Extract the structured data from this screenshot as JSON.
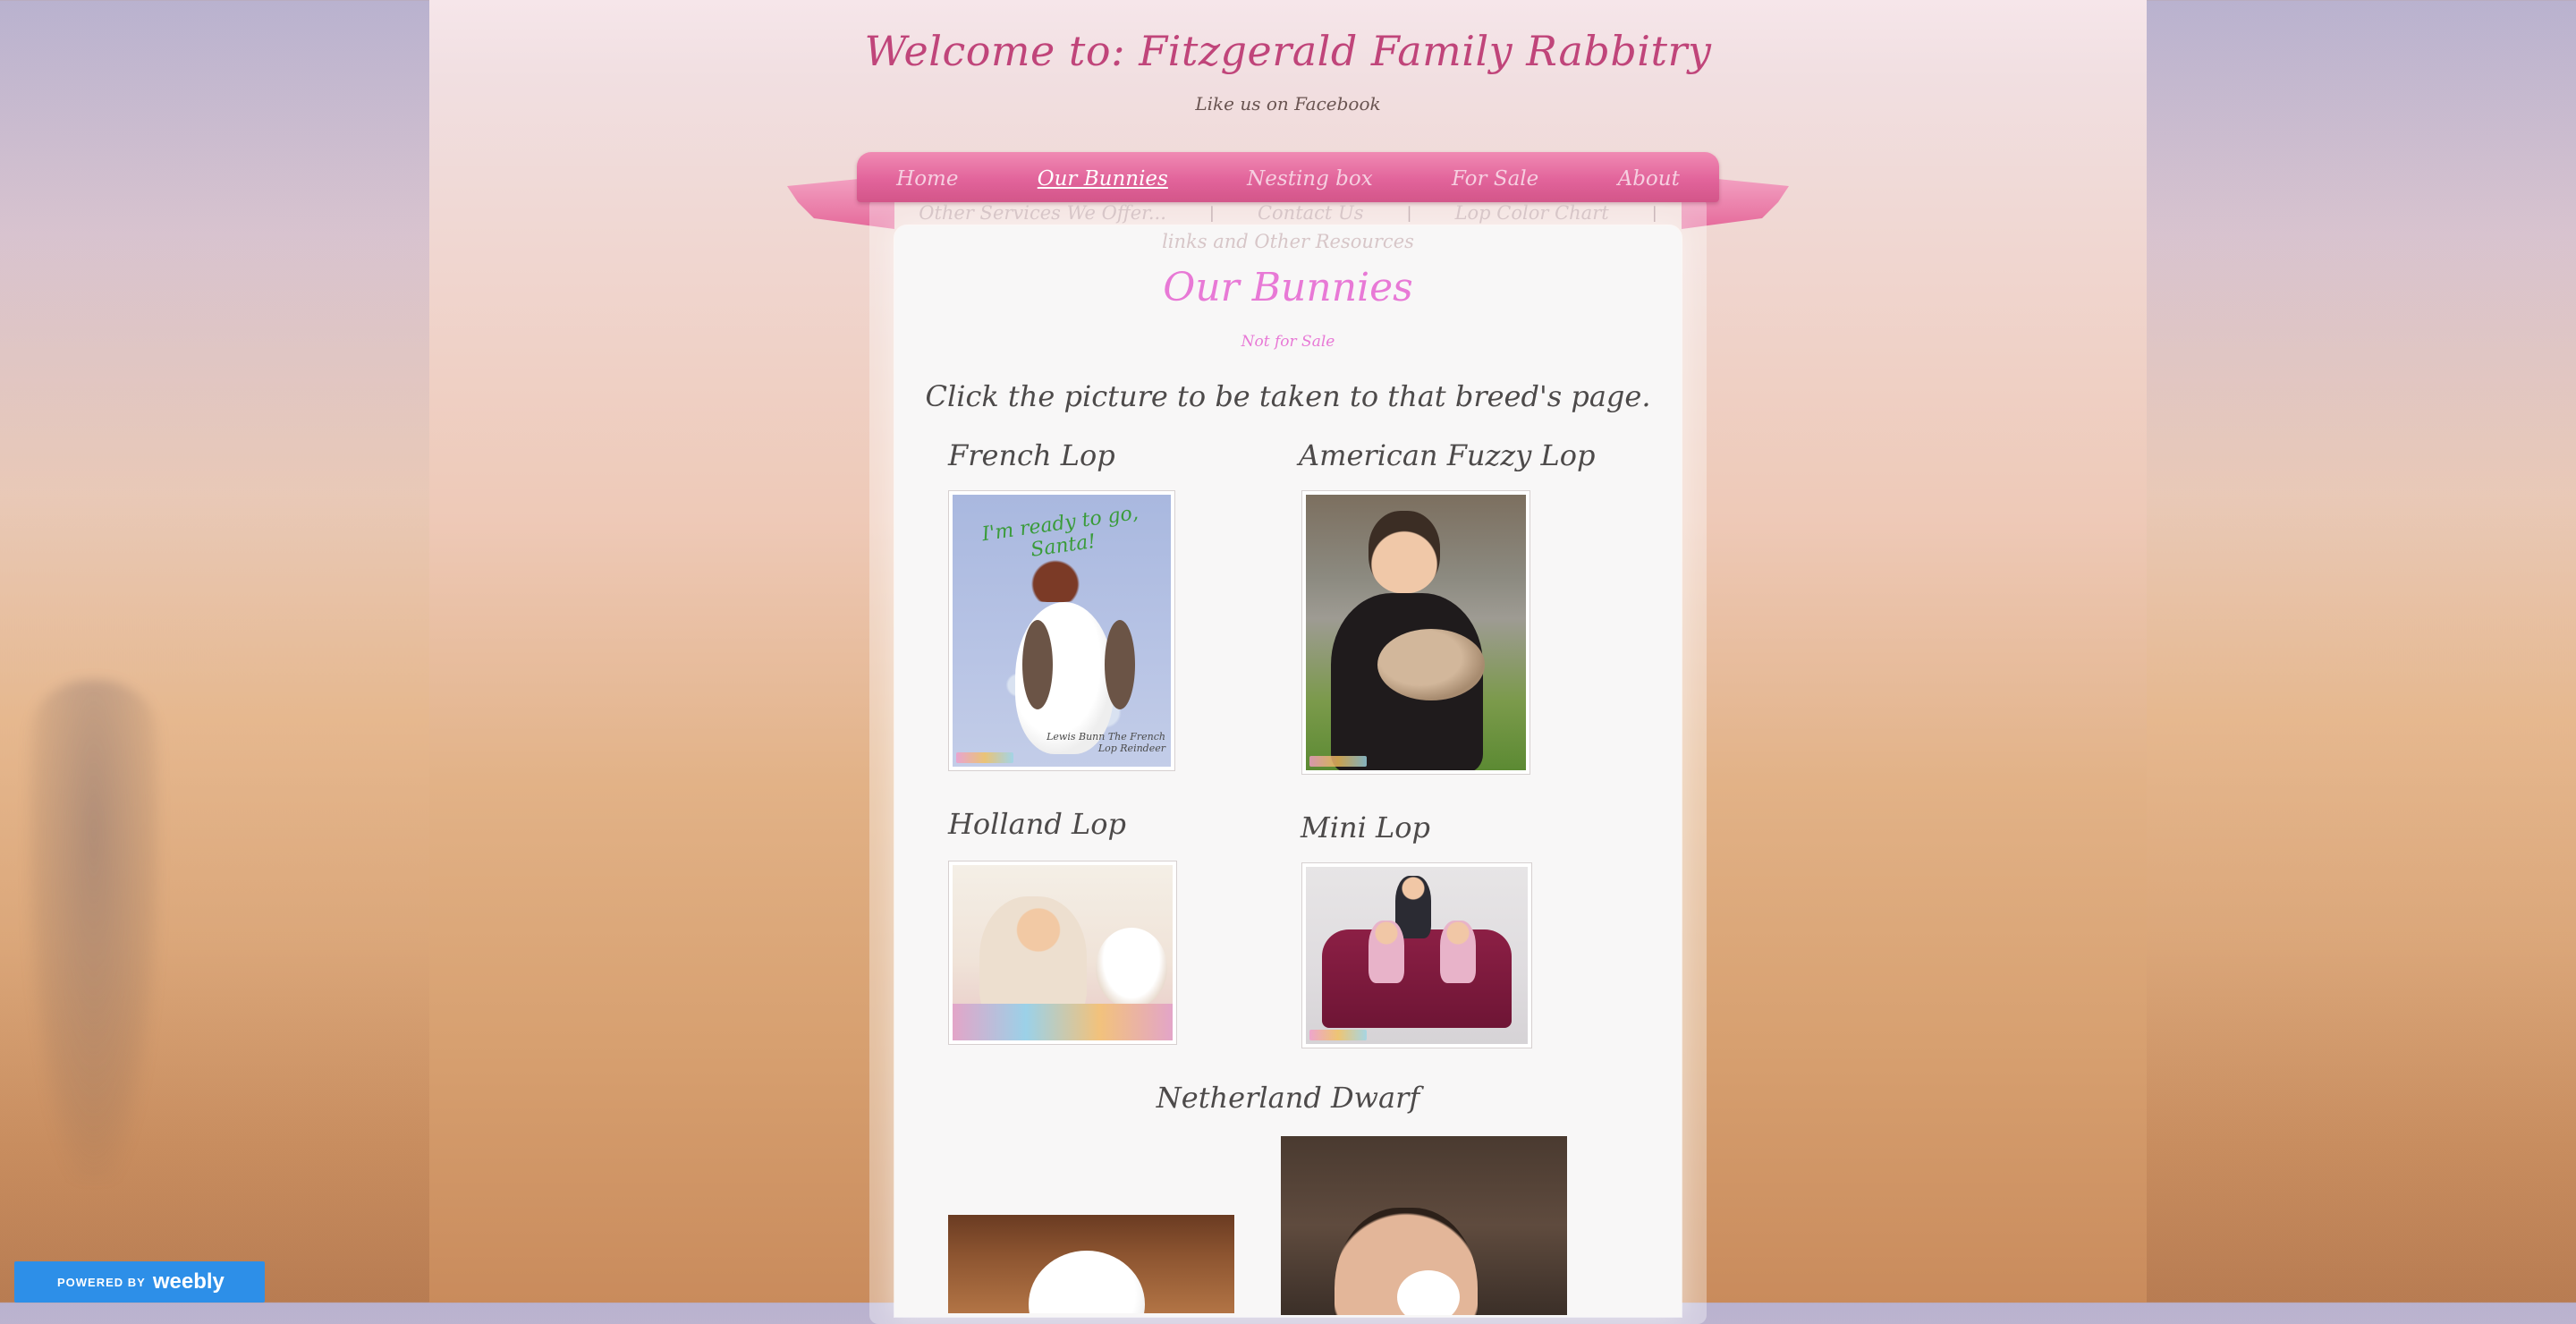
{
  "site": {
    "title": "Welcome to: Fitzgerald Family Rabbitry",
    "facebook_link": "Like us on Facebook"
  },
  "nav": {
    "primary": [
      {
        "label": "Home",
        "active": false
      },
      {
        "label": "Our Bunnies",
        "active": true
      },
      {
        "label": "Nesting box",
        "active": false
      },
      {
        "label": "For Sale",
        "active": false
      },
      {
        "label": "About",
        "active": false
      }
    ],
    "secondary": [
      {
        "label": "Other Services We Offer..."
      },
      {
        "label": "Contact Us"
      },
      {
        "label": "Lop Color Chart"
      }
    ],
    "tertiary": [
      {
        "label": "links and Other Resources"
      }
    ]
  },
  "page": {
    "heading": "Our Bunnies",
    "subheading": "Not for Sale",
    "intro": "Click the picture to be taken to that breed's page."
  },
  "breeds": [
    {
      "name": "French Lop",
      "photo_caption": "I'm ready to go, Santa!",
      "photo_credit_line1": "Lewis Bunn The French",
      "photo_credit_line2": "Lop Reindeer"
    },
    {
      "name": "American Fuzzy Lop"
    },
    {
      "name": "Holland Lop"
    },
    {
      "name": "Mini Lop"
    },
    {
      "name": "Netherland Dwarf"
    }
  ],
  "footer_badge": {
    "powered_by": "POWERED BY",
    "brand": "weebly"
  },
  "colors": {
    "title_pink": "#c0457a",
    "heading_pink": "#e879d6",
    "nav_ribbon": "#e2649b",
    "badge_blue": "#2d8fe8",
    "body_text": "#4d4a4a"
  },
  "icons": [
    "ribbon-left-icon",
    "ribbon-right-icon",
    "weebly-logo-icon"
  ]
}
